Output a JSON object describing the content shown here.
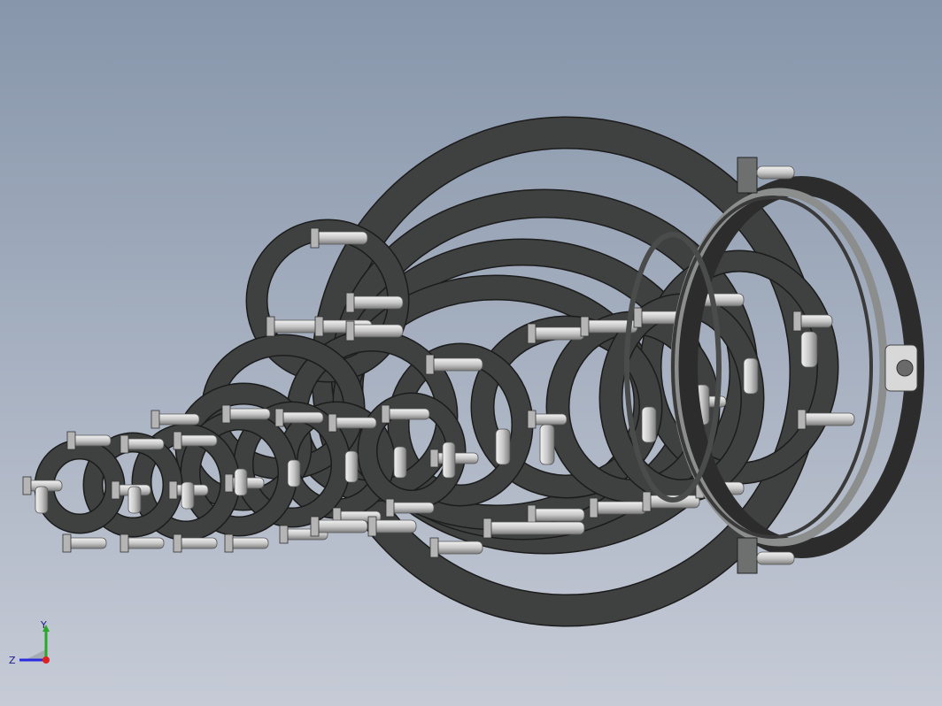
{
  "viewport": {
    "name": "3d-graphics-area",
    "model": "pipe-clamp-assembly",
    "background_top": "#8796ab",
    "background_bottom": "#c6cbd6"
  },
  "triad": {
    "y_label": "Y",
    "z_label": "Z",
    "y_color": "#2aa82a",
    "z_color": "#2a2ae0",
    "x_color": "#e02020"
  },
  "colors": {
    "ring_dark": "#3f4040",
    "ring_edge": "#1c1c1c",
    "ring_face": "#8a8c8c",
    "bolt_light": "#e4e4e4",
    "bolt_shade": "#8e8e8e"
  }
}
